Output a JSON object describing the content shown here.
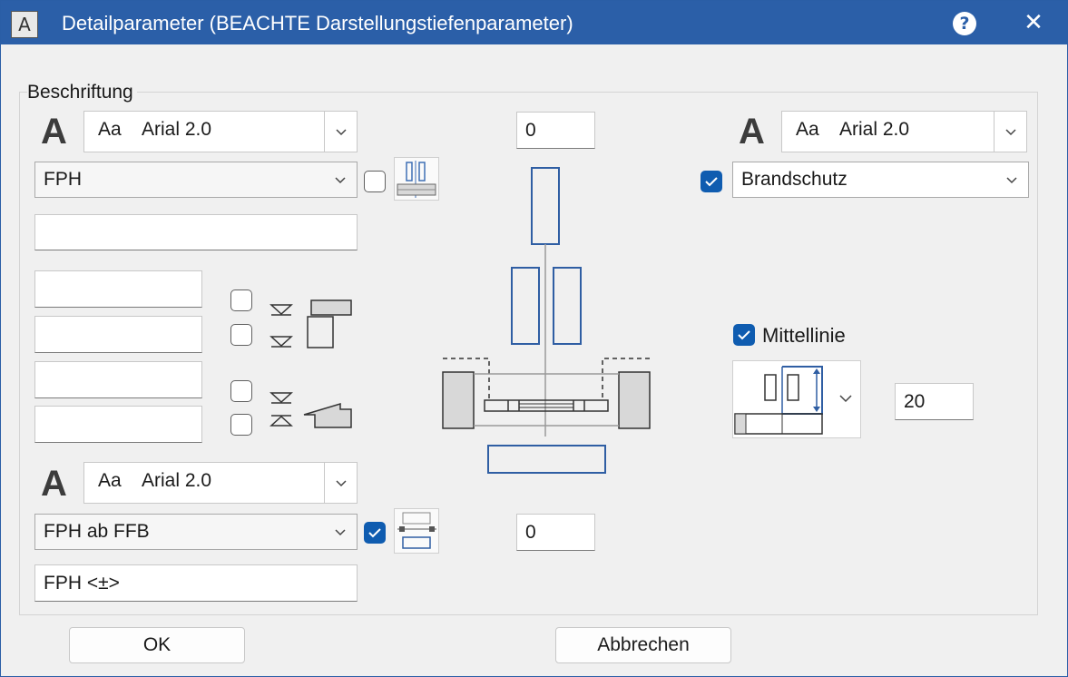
{
  "window": {
    "title": "Detailparameter (BEACHTE Darstellungstiefenparameter)",
    "help": "?",
    "close": "✕",
    "app_icon": "A"
  },
  "group": {
    "label": "Beschriftung"
  },
  "fonts": {
    "top_left": {
      "prefix": "Aa",
      "name": "Arial 2.0"
    },
    "top_right": {
      "prefix": "Aa",
      "name": "Arial 2.0"
    },
    "bottom_left": {
      "prefix": "Aa",
      "name": "Arial 2.0"
    },
    "letter": "A"
  },
  "left": {
    "type_select": "FPH",
    "type_checkbox_checked": false,
    "text_field": "",
    "fields": [
      "",
      "",
      "",
      ""
    ],
    "stack_checkboxes": [
      false,
      false,
      false,
      false
    ]
  },
  "center": {
    "top_value": "0",
    "bottom_value": "0"
  },
  "right": {
    "category_checked": true,
    "category_select": "Brandschutz",
    "mittellinie_checked": true,
    "mittellinie_label": "Mittellinie",
    "offset_value": "20"
  },
  "bottom": {
    "ref_select": "FPH ab FFB",
    "ref_checkbox_checked": true,
    "format_field": "FPH <±>"
  },
  "buttons": {
    "ok": "OK",
    "cancel": "Abbrechen"
  },
  "colors": {
    "titlebar": "#2b5fa8",
    "accent": "#0f5cb0",
    "drawing_blue": "#2f5ea3"
  },
  "icons": [
    "app-icon",
    "help-icon",
    "close-icon",
    "chevron-down-icon",
    "check-icon"
  ]
}
